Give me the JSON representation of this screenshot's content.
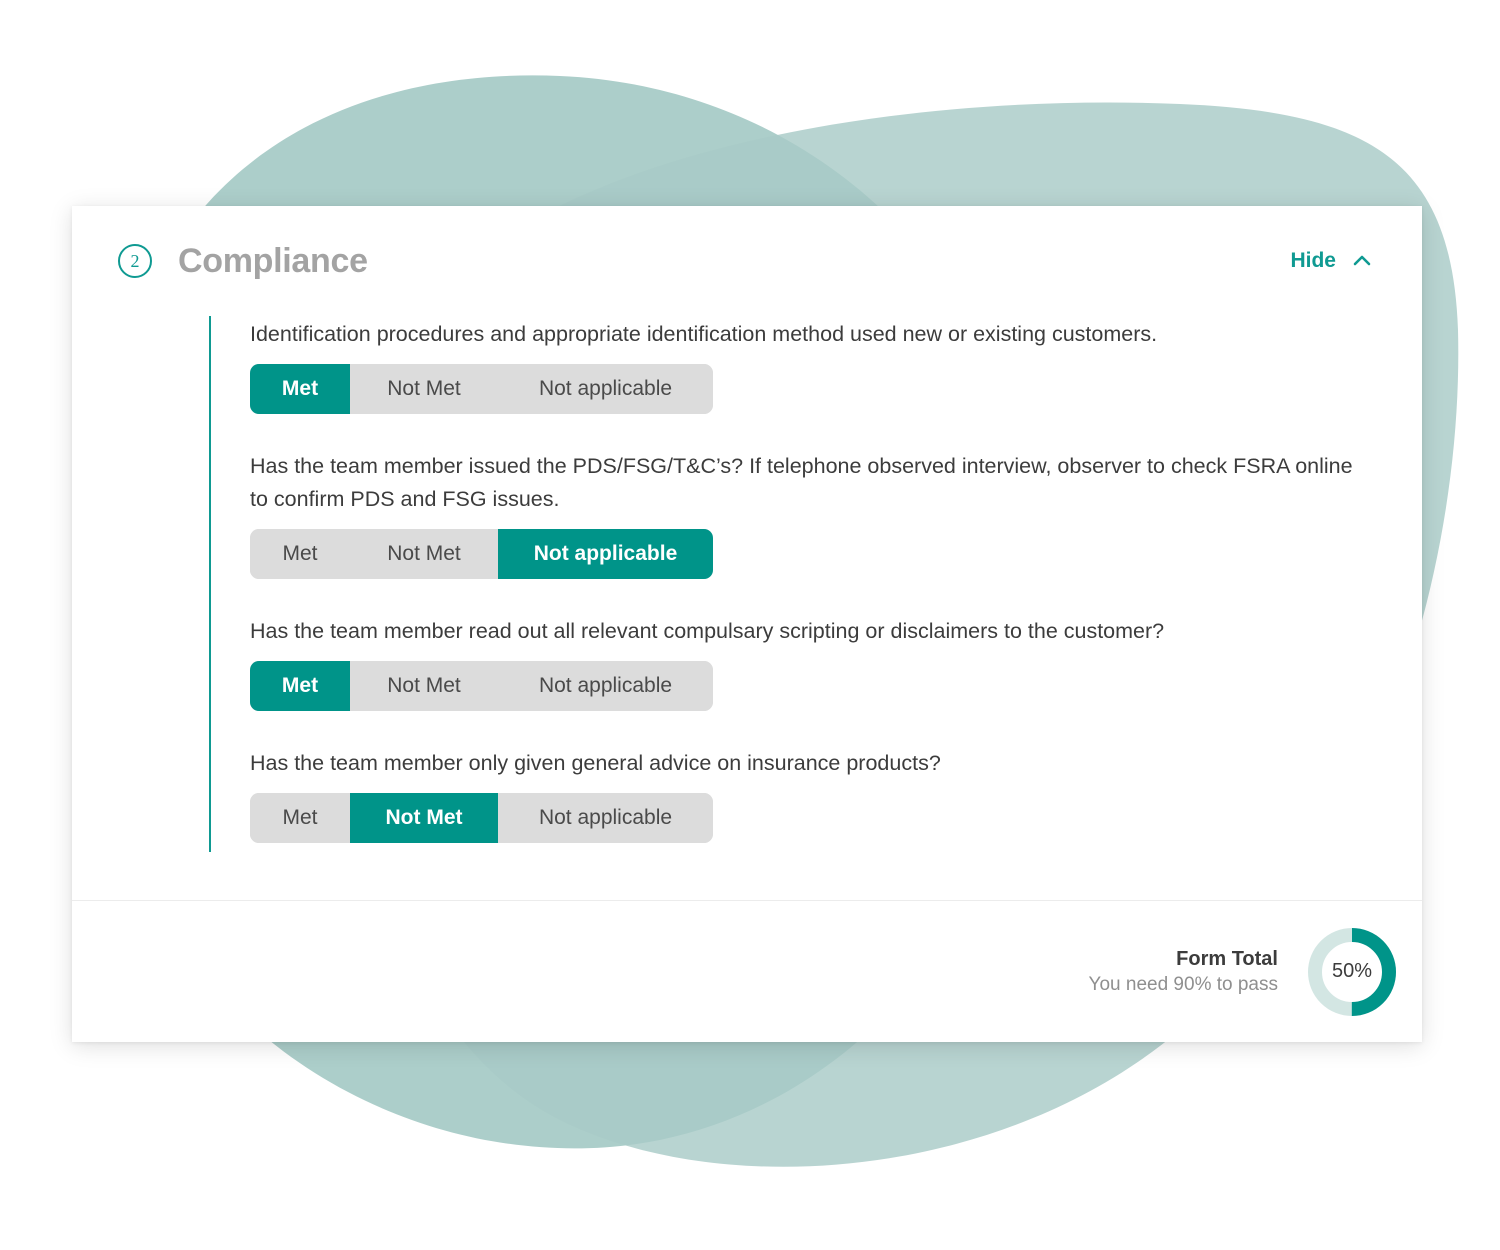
{
  "theme": {
    "teal": "#009489",
    "teal_dark": "#0f9a92",
    "blob": "#a8cbc7",
    "blob_overlap": "#7fb3ac",
    "segment_bg": "#dcdcdc",
    "segment_text": "#4a4a4a",
    "title_gray": "#a3a3a3",
    "body_text": "#3c3c3c",
    "muted_text": "#8f8f8f",
    "donut_track": "#d3e6e3"
  },
  "section": {
    "step_number": "2",
    "title": "Compliance",
    "toggle_label": "Hide",
    "toggle_icon": "chevron-up-icon"
  },
  "options": {
    "met": "Met",
    "not_met": "Not Met",
    "not_applicable": "Not applicable"
  },
  "questions": [
    {
      "text": "Identification procedures and appropriate identification method used new or existing customers.",
      "selected": "met"
    },
    {
      "text": "Has the team member issued the PDS/FSG/T&C’s? If telephone observed interview, observer to check FSRA online to confirm PDS and FSG issues.",
      "selected": "not_applicable"
    },
    {
      "text": "Has the team member read out all relevant compulsary scripting or disclaimers to the customer?",
      "selected": "met"
    },
    {
      "text": "Has the team member only given general advice on insurance products?",
      "selected": "not_met"
    }
  ],
  "footer": {
    "total_label": "Form Total",
    "total_sub": "You need 90% to pass",
    "score_percent": "50%",
    "score_value": 50,
    "pass_threshold": "90%"
  }
}
